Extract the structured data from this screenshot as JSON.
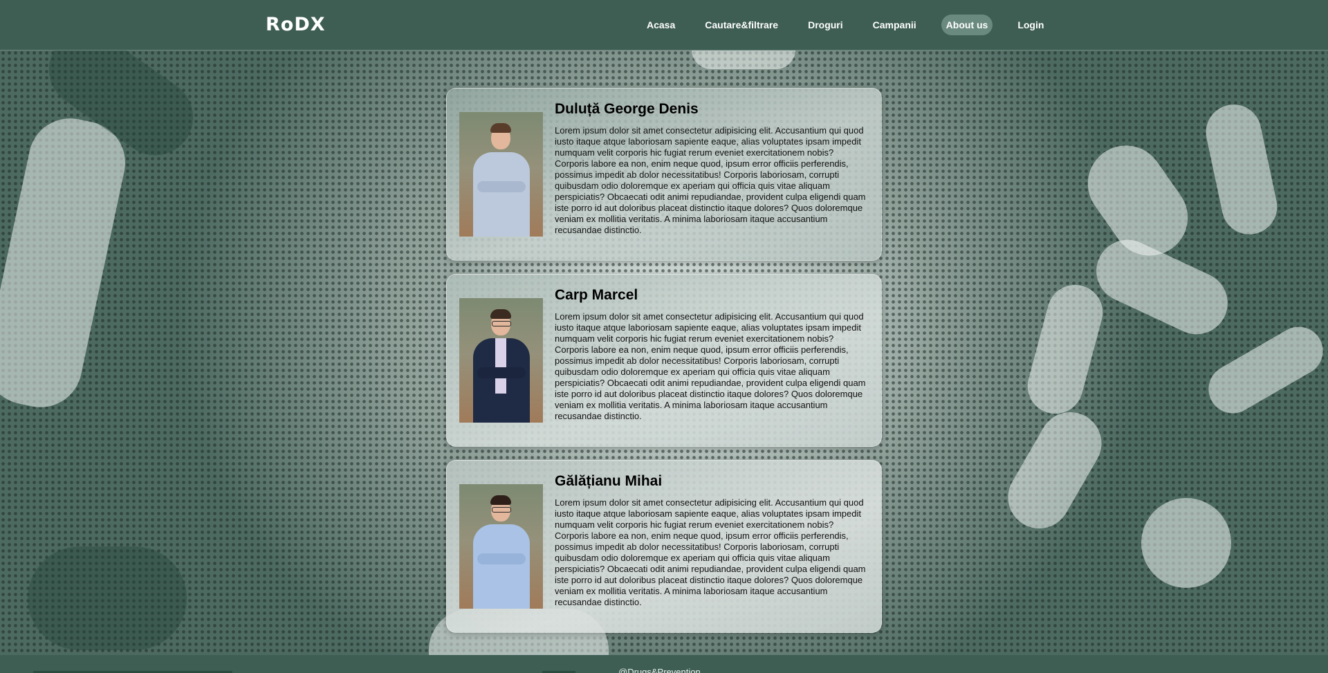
{
  "header": {
    "logo": "RoDX",
    "nav": [
      {
        "label": "Acasa",
        "active": false
      },
      {
        "label": "Cautare&filtrare",
        "active": false
      },
      {
        "label": "Droguri",
        "active": false
      },
      {
        "label": "Campanii",
        "active": false
      },
      {
        "label": "About us",
        "active": true
      },
      {
        "label": "Login",
        "active": false
      }
    ]
  },
  "members": [
    {
      "name": "Duluță George Denis",
      "photo_shirt_color": "#bcc9dc",
      "glasses": false,
      "bio": "Lorem ipsum dolor sit amet consectetur adipisicing elit. Accusantium qui quod iusto itaque atque laboriosam sapiente eaque, alias voluptates ipsam impedit numquam velit corporis hic fugiat rerum eveniet exercitationem nobis? Corporis labore ea non, enim neque quod, ipsum error officiis perferendis, possimus impedit ab dolor necessitatibus! Corporis laboriosam, corrupti quibusdam odio doloremque ex aperiam qui officia quis vitae aliquam perspiciatis? Obcaecati odit animi repudiandae, provident culpa eligendi quam iste porro id aut doloribus placeat distinctio itaque dolores? Quos doloremque veniam ex mollitia veritatis. A minima laboriosam itaque accusantium recusandae distinctio."
    },
    {
      "name": "Carp Marcel",
      "photo_shirt_color": "#1f2a44",
      "glasses": true,
      "bio": "Lorem ipsum dolor sit amet consectetur adipisicing elit. Accusantium qui quod iusto itaque atque laboriosam sapiente eaque, alias voluptates ipsam impedit numquam velit corporis hic fugiat rerum eveniet exercitationem nobis? Corporis labore ea non, enim neque quod, ipsum error officiis perferendis, possimus impedit ab dolor necessitatibus! Corporis laboriosam, corrupti quibusdam odio doloremque ex aperiam qui officia quis vitae aliquam perspiciatis? Obcaecati odit animi repudiandae, provident culpa eligendi quam iste porro id aut doloribus placeat distinctio itaque dolores? Quos doloremque veniam ex mollitia veritatis. A minima laboriosam itaque accusantium recusandae distinctio."
    },
    {
      "name": "Gălățianu Mihai",
      "photo_shirt_color": "#a9c2e6",
      "glasses": true,
      "bio": "Lorem ipsum dolor sit amet consectetur adipisicing elit. Accusantium qui quod iusto itaque atque laboriosam sapiente eaque, alias voluptates ipsam impedit numquam velit corporis hic fugiat rerum eveniet exercitationem nobis? Corporis labore ea non, enim neque quod, ipsum error officiis perferendis, possimus impedit ab dolor necessitatibus! Corporis laboriosam, corrupti quibusdam odio doloremque ex aperiam qui officia quis vitae aliquam perspiciatis? Obcaecati odit animi repudiandae, provident culpa eligendi quam iste porro id aut doloribus placeat distinctio itaque dolores? Quos doloremque veniam ex mollitia veritatis. A minima laboriosam itaque accusantium recusandae distinctio."
    }
  ],
  "footer": {
    "text": "@Drugs&Prevention"
  },
  "colors": {
    "header_bg": "#3e5e54",
    "nav_active_bg": "#6a8a7f",
    "text_on_header": "#ffffff"
  }
}
